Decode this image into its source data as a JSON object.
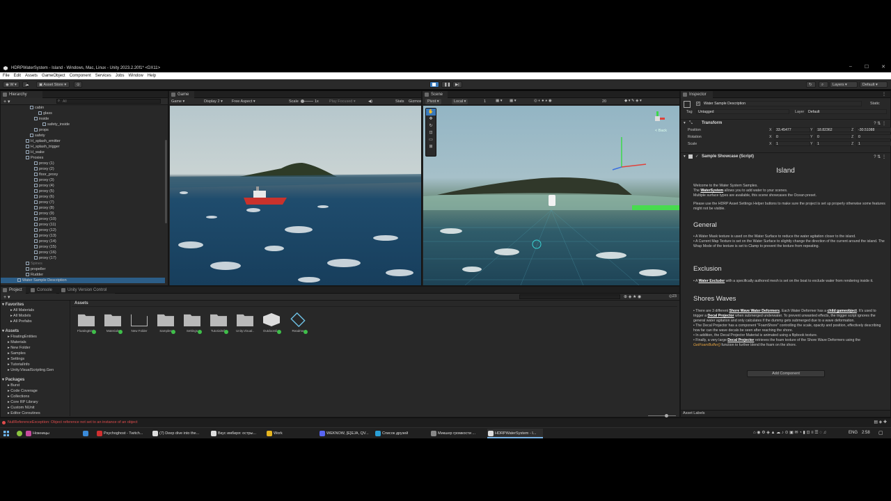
{
  "window": {
    "title": "HDRPWaterSystem - Island - Windows, Mac, Linux - Unity 2023.2.20f1* <DX11>",
    "controls": [
      "–",
      "☐",
      "✕"
    ]
  },
  "menu": [
    "File",
    "Edit",
    "Assets",
    "GameObject",
    "Component",
    "Services",
    "Jobs",
    "Window",
    "Help"
  ],
  "toolbar": {
    "account": "W",
    "asset_store": "Asset Store",
    "layers": "Layers",
    "layout": "Default"
  },
  "hierarchy": {
    "tab": "Hierarchy",
    "search_placeholder": "All",
    "items": [
      {
        "label": "cabin",
        "indent": 7
      },
      {
        "label": "glass",
        "indent": 9
      },
      {
        "label": "inside",
        "indent": 8
      },
      {
        "label": "safety_inside",
        "indent": 10
      },
      {
        "label": "props",
        "indent": 8
      },
      {
        "label": "safety",
        "indent": 7
      },
      {
        "label": "H_splash_emitter",
        "indent": 6
      },
      {
        "label": "H_splash_trigger",
        "indent": 6
      },
      {
        "label": "H_wake",
        "indent": 6
      },
      {
        "label": "Proxies",
        "indent": 6
      },
      {
        "label": "proxy (1)",
        "indent": 8
      },
      {
        "label": "proxy (2)",
        "indent": 8
      },
      {
        "label": "floor_proxy",
        "indent": 8
      },
      {
        "label": "proxy (3)",
        "indent": 8
      },
      {
        "label": "proxy (4)",
        "indent": 8
      },
      {
        "label": "proxy (5)",
        "indent": 8
      },
      {
        "label": "proxy (6)",
        "indent": 8
      },
      {
        "label": "proxy (7)",
        "indent": 8
      },
      {
        "label": "proxy (8)",
        "indent": 8
      },
      {
        "label": "proxy (9)",
        "indent": 8
      },
      {
        "label": "proxy (10)",
        "indent": 8
      },
      {
        "label": "proxy (11)",
        "indent": 8
      },
      {
        "label": "proxy (12)",
        "indent": 8
      },
      {
        "label": "proxy (13)",
        "indent": 8
      },
      {
        "label": "proxy (14)",
        "indent": 8
      },
      {
        "label": "proxy (15)",
        "indent": 8
      },
      {
        "label": "proxy (16)",
        "indent": 8
      },
      {
        "label": "proxy (17)",
        "indent": 8
      },
      {
        "label": "Spines",
        "indent": 6
      },
      {
        "label": "propeller",
        "indent": 6
      },
      {
        "label": "Rudder",
        "indent": 6
      },
      {
        "label": "Water Sample Description",
        "indent": 4
      }
    ]
  },
  "game": {
    "tab": "Game",
    "mode": "Game",
    "display": "Display 2",
    "aspect": "Free Aspect",
    "scale_label": "Scale",
    "scale_value": "1x",
    "play_focused": "Play Focused",
    "stats": "Stats",
    "gizmos": "Gizmos"
  },
  "scene": {
    "tab": "Scene",
    "pivot": "Pivot",
    "local": "Local",
    "grid_value": "1",
    "fov": "20",
    "back": "< Back"
  },
  "inspector": {
    "tab": "Inspector",
    "object_name": "Water Sample Description",
    "static_label": "Static",
    "tag_label": "Tag",
    "tag_value": "Untagged",
    "layer_label": "Layer",
    "layer_value": "Default",
    "transform": {
      "title": "Transform",
      "rows": [
        {
          "label": "Position",
          "x": "33.45477",
          "y": "18.82362",
          "z": "-30.51088"
        },
        {
          "label": "Rotation",
          "x": "0",
          "y": "0",
          "z": "0"
        },
        {
          "label": "Scale",
          "x": "1",
          "y": "1",
          "z": "1"
        }
      ]
    },
    "script": {
      "title": "Sample Showcase (Script)",
      "heading": "Island",
      "intro1": "Welcome to the Water System Samples.",
      "intro2a": "The ",
      "intro2link": "WaterSystem",
      "intro2b": " allows you to add water to your scenes.",
      "intro3": "Multiple surface types are available, this scene showcases the Ocean preset.",
      "intro4": "Please use the HDRP Asset Settings Helper buttons to make sure the project is set up properly otherwise some features might not be visible.",
      "general_h": "General",
      "general1": "• A Water Mask texture is used on the Water Surface to reduce the water agitation closer to the island.",
      "general2": "• A Current Map Texture is set on the Water Surface to slightly change the direction of the current around the island. The Wrap Mode of the texture is set to Clamp to prevent the texture from repeating.",
      "exclusion_h": "Exclusion",
      "excl_a": "• A ",
      "excl_link": "Water Excluder",
      "excl_b": " with a specifically authored mesh is set on the boat to exclude water from rendering inside it.",
      "shores_h": "Shores Waves",
      "sh1a": "• There are 3 different ",
      "sh1link": "Shore Wave Water Deformers",
      "sh1b": ". Each Water Deformer has a ",
      "sh1link2": "child gameobject",
      "sh1c": ". It's used to trigger a ",
      "sh1link3": "Decal Projector",
      "sh1d": " when submerged underwater. To prevent unwanted effects, the trigger script ignores the general water agitation and only calculates if the dummy gets submerged due to a wave deformation.",
      "sh2": "• The Decal Projector has a component \"FoamShore\" controlling the scale, opacity and position, effectively describing how far can the wave decals be seen after reaching the shore.",
      "sh3": "• In addition, the Decal Projector Material is animated using a flipbook texture.",
      "sh4a": "• Finally, a very large ",
      "sh4link": "Decal Projector",
      "sh4b": " retrieves the foam texture of the Shore Wave Deformers using the ",
      "sh4func": "GetFoamBuffer()",
      "sh4c": " function to further blend the foam on the shore."
    },
    "add_component": "Add Component",
    "asset_labels": "Asset Labels"
  },
  "project": {
    "tabs": [
      "Project",
      "Console",
      "Unity Version Control"
    ],
    "breadcrumb": "Assets",
    "count": "23",
    "favorites_h": "Favorites",
    "favorites": [
      "All Materials",
      "All Models",
      "All Prefabs"
    ],
    "assets_h": "Assets",
    "assets_tree": [
      "FloatingEntities",
      "Materials",
      "New Folder",
      "Samples",
      "Settings",
      "TutorialInfo",
      "Unity.VisualScripting.Gen"
    ],
    "packages_h": "Packages",
    "packages": [
      "Burst",
      "Code Coverage",
      "Collections",
      "Core RP Library",
      "Custom NUnit",
      "Editor Coroutines",
      "High Definition RP",
      "High Definition RP Config"
    ],
    "folders": [
      {
        "label": "FloatingEnti...",
        "kind": "folder",
        "badge": true
      },
      {
        "label": "Materials",
        "kind": "folder",
        "badge": true
      },
      {
        "label": "New Folder",
        "kind": "empty",
        "badge": false
      },
      {
        "label": "Samples",
        "kind": "folder",
        "badge": true
      },
      {
        "label": "Settings",
        "kind": "folder",
        "badge": true
      },
      {
        "label": "TutorialInfo",
        "kind": "folder",
        "badge": true
      },
      {
        "label": "Unity.Visual...",
        "kind": "folder",
        "badge": false
      },
      {
        "label": "Outdoorsli...",
        "kind": "unity",
        "badge": true
      },
      {
        "label": "Readme",
        "kind": "readme",
        "badge": true
      }
    ]
  },
  "status": {
    "error": "NullReferenceException: Object reference not set to an instance of an object"
  },
  "taskbar": {
    "items": [
      {
        "label": "Ножницы",
        "color": "#c84b9e"
      },
      {
        "label": "",
        "color": "#3b8ad8"
      },
      {
        "label": "Psychoghost - Twitch...",
        "color": "#d03030"
      },
      {
        "label": "(7) Deep dive into the...",
        "color": "#ddd"
      },
      {
        "label": "Вкус имбиря: остры...",
        "color": "#ddd"
      },
      {
        "label": "Work",
        "color": "#e6b520"
      },
      {
        "label": "WEKNOW, [E]EJA, QV...",
        "color": "#5865f2"
      },
      {
        "label": "Список друзей",
        "color": "#2a9fd6"
      },
      {
        "label": "Микшер громкости ...",
        "color": "#888"
      },
      {
        "label": "HDRPWaterSystem - I...",
        "color": "#ddd"
      }
    ],
    "lang": "ENG",
    "time": "2:58"
  },
  "colors": {
    "accent": "#3a79bb",
    "error": "#e04c4c",
    "badge": "#3fbf4a"
  }
}
